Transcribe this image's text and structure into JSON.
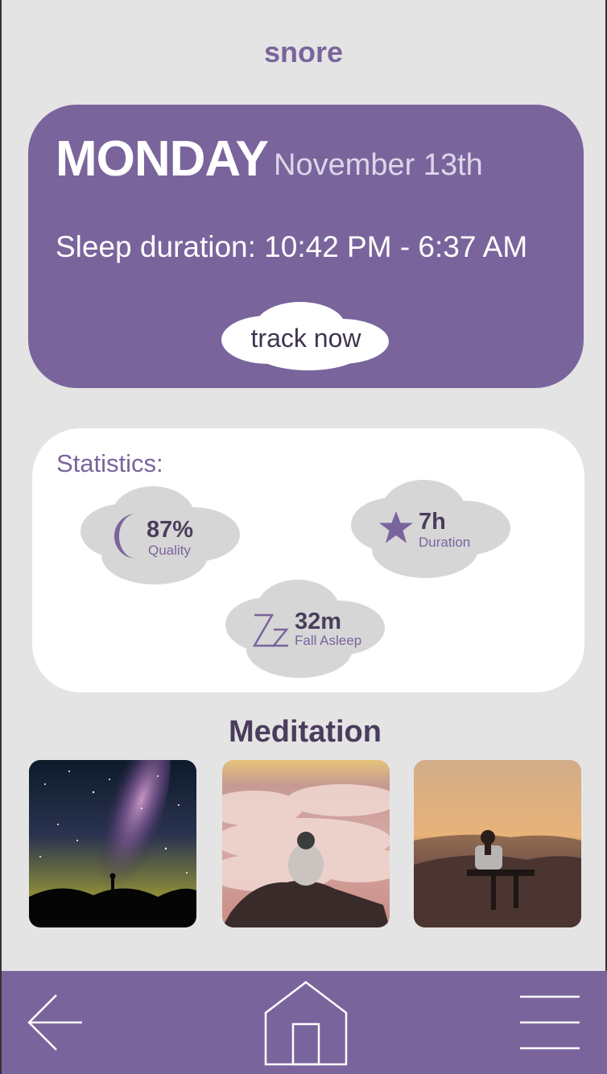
{
  "app": {
    "title": "snore"
  },
  "today": {
    "day": "MONDAY",
    "date": "November 13th",
    "sleep_duration": "Sleep duration: 10:42 PM - 6:37 AM",
    "track_label": "track now"
  },
  "statistics": {
    "title": "Statistics:",
    "items": [
      {
        "icon": "moon-icon",
        "value": "87%",
        "label": "Quality"
      },
      {
        "icon": "star-icon",
        "value": "7h",
        "label": "Duration"
      },
      {
        "icon": "zz-icon",
        "value": "32m",
        "label": "Fall Asleep"
      }
    ]
  },
  "meditation": {
    "title": "Meditation",
    "items": [
      {
        "scene": "milky-way-night-sky"
      },
      {
        "scene": "person-above-clouds"
      },
      {
        "scene": "person-on-bench-sunset"
      }
    ]
  },
  "nav": {
    "back": "back-arrow-icon",
    "home": "home-icon",
    "menu": "menu-icon"
  },
  "colors": {
    "accent": "#7a649c",
    "background": "#e4e4e4",
    "cloud": "#d6d6d6"
  }
}
